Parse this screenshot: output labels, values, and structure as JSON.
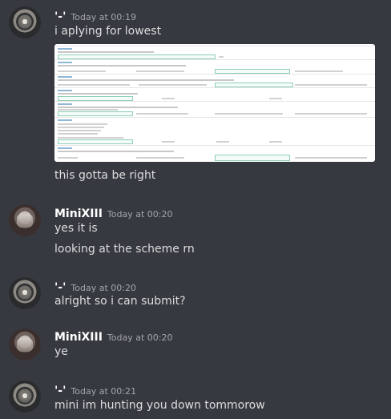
{
  "messages": [
    {
      "author": "'-'",
      "timestamp": "Today at 00:19",
      "lines": [
        "i aplying for lowest",
        "this gotta be right"
      ],
      "attachment": "screenshot-of-form"
    },
    {
      "author": "MiniXIII",
      "timestamp": "Today at 00:20",
      "lines": [
        "yes it is",
        "looking at the scheme rn"
      ]
    },
    {
      "author": "'-'",
      "timestamp": "Today at 00:20",
      "lines": [
        "alright so i can submit?"
      ]
    },
    {
      "author": "MiniXIII",
      "timestamp": "Today at 00:20",
      "lines": [
        "ye"
      ]
    },
    {
      "author": "'-'",
      "timestamp": "Today at 00:21",
      "lines": [
        "mini im hunting you down tommorow"
      ]
    }
  ],
  "colors": {
    "background": "#36393f",
    "text": "#dcddde",
    "username": "#ffffff",
    "timestamp": "#a3a6aa"
  },
  "avatars": {
    "user_a": "cat-avatar",
    "user_b": "man-avatar"
  }
}
